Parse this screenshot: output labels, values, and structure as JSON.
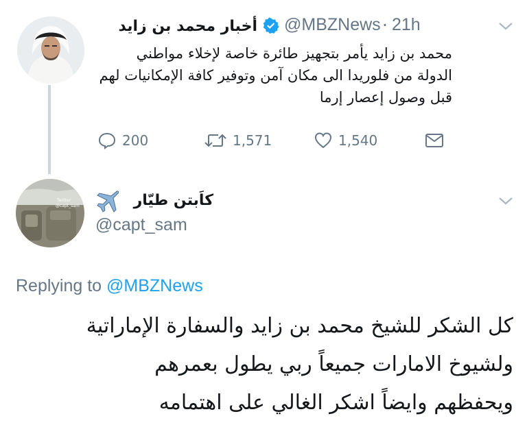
{
  "parent_tweet": {
    "name": "أخبار محمد بن زايد",
    "handle": "@MBZNews",
    "separator": "·",
    "time": "21h",
    "text_lines": [
      "محمد بن زايد يأمر بتجهيز طائرة خاصة لإخلاء مواطني",
      "الدولة من فلوريدا الى مكان آمن وتوفير كافة الإمكانيات لهم",
      "قبل وصول إعصار إرما"
    ],
    "actions": {
      "replies": "200",
      "retweets": "1,571",
      "likes": "1,540"
    }
  },
  "reply_tweet": {
    "name": "كاَبتن طيّار",
    "handle": "@capt_sam",
    "avatar_text_1": "Twitter",
    "avatar_text_2": "@capt_sam",
    "replying_prefix": "Replying to",
    "replying_handle": "@MBZNews",
    "text_lines": [
      "كل الشكر للشيخ محمد بن زايد والسفارة الإماراتية",
      "ولشيوخ الامارات جميعاً ربي يطول بعمرهم",
      "ويحفظهم وايضاً اشكر الغالي على اهتمامه"
    ]
  },
  "colors": {
    "accent": "#1da1f2",
    "muted": "#657786",
    "verified": "#1da1f2",
    "chevron": "#aab8c2"
  },
  "icons": [
    "chevron-down-icon",
    "verified-badge-icon",
    "reply-icon",
    "retweet-icon",
    "like-icon",
    "message-icon",
    "airplane-emoji-icon"
  ]
}
